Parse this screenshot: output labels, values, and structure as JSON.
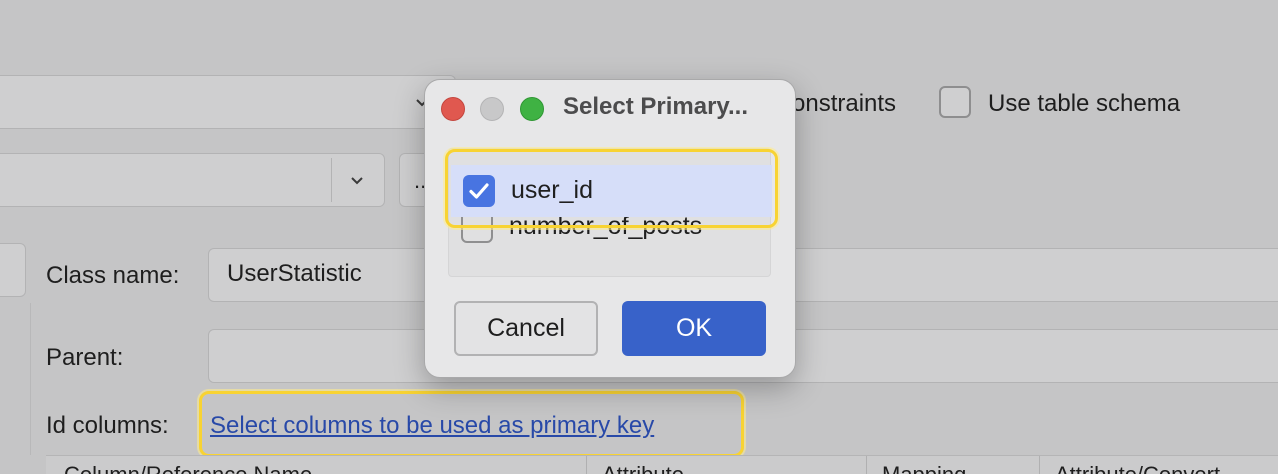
{
  "background": {
    "constraints_text": "onstraints",
    "use_table_schema_label": "Use table schema",
    "class_name_label": "Class name:",
    "class_name_value": "UserStatistic",
    "parent_label": "Parent:",
    "parent_value": "",
    "id_columns_label": "Id columns:",
    "id_columns_link": "Select columns to be used as primary key",
    "table_headers": [
      "Column/Reference Name",
      "Attribute",
      "Mapping",
      "Attribute/Convert"
    ],
    "more_button_label": "..."
  },
  "dialog": {
    "title": "Select Primary...",
    "items": [
      {
        "label": "user_id",
        "checked": true
      },
      {
        "label": "number_of_posts",
        "checked": false
      }
    ],
    "cancel_label": "Cancel",
    "ok_label": "OK"
  },
  "colors": {
    "highlight": "#f8d332",
    "accent": "#3862c9",
    "traffic_close": "#e0584f",
    "traffic_min": "#c8c8c9",
    "traffic_max": "#3fb243"
  }
}
